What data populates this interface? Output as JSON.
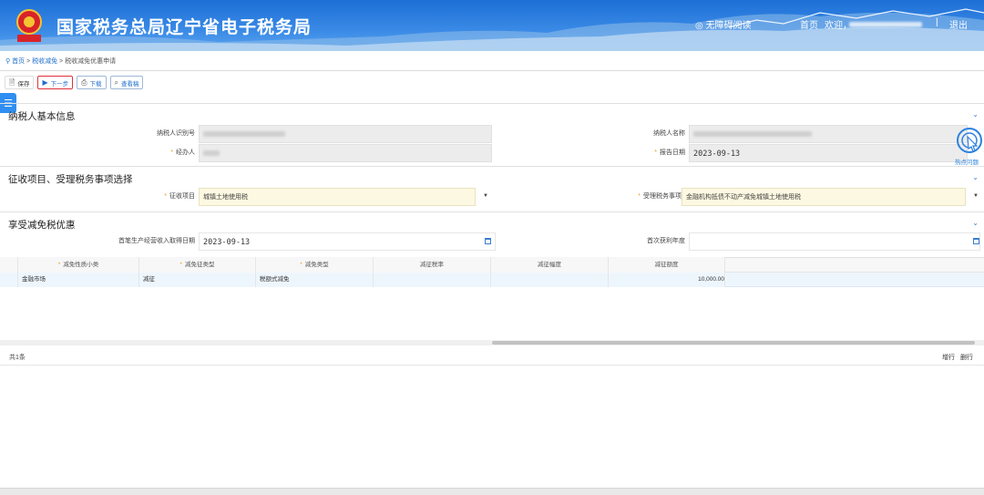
{
  "header": {
    "site_title": "国家税务总局辽宁省电子税务局",
    "accessibility_label": "无障碍阅读",
    "home_label": "首页",
    "welcome_label": "欢迎，",
    "separator": "|",
    "logout_label": "退出",
    "emblem_text": "税务"
  },
  "breadcrumb": {
    "home": "首页",
    "sep1": ">",
    "section": "税收减免",
    "sep2": ">",
    "current": "税收减免优惠申请"
  },
  "toolbar": {
    "save": "保存",
    "next": "下一步",
    "download": "下载",
    "review": "查看稿"
  },
  "section_basic": {
    "title": "纳税人基本信息",
    "taxpayer_id_label": "纳税人识别号",
    "taxpayer_name_label": "纳税人名称",
    "handler_label": "经办人",
    "report_date_label": "报告日期",
    "report_date_value": "2023-09-13"
  },
  "section_collection": {
    "title": "征收项目、受理税务事项选择",
    "item_label": "征收项目",
    "item_value": "城镇土地使用税",
    "matter_label": "受理税务事项",
    "matter_value": "金融机构抵债不动产减免城镇土地使用税"
  },
  "section_relief": {
    "title": "享受减免税优惠",
    "first_income_date_label": "首笔生产经营收入取得日期",
    "first_income_date_value": "2023-09-13",
    "first_profit_year_label": "首次获利年度"
  },
  "grid": {
    "headers": [
      "减免性质小类",
      "减免征类型",
      "减免类型",
      "减征税率",
      "减征幅度",
      "减征额度"
    ],
    "required": [
      true,
      true,
      true,
      false,
      false,
      false
    ],
    "row": [
      "金融市场",
      "减征",
      "税额式减免",
      "",
      "",
      "10,000.00"
    ]
  },
  "footer": {
    "count": "共1条",
    "add_row": "增行",
    "delete_row": "删行"
  },
  "chat": {
    "label": "热点问题"
  },
  "required_mark": "*"
}
